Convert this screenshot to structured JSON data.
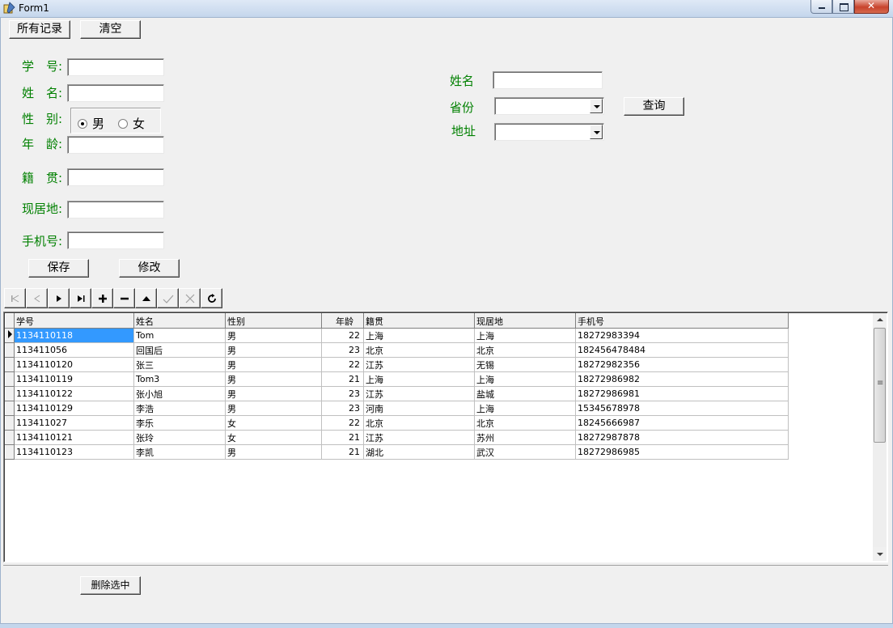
{
  "window": {
    "title": "Form1"
  },
  "toolbar": {
    "all_records": "所有记录",
    "clear": "清空"
  },
  "form": {
    "student_id_label": "学　号:",
    "name_label": "姓　名:",
    "gender_label": "性　别:",
    "gender_options": {
      "male": "男",
      "female": "女"
    },
    "gender_selected": "男",
    "age_label": "年　龄:",
    "native_label": "籍　贯:",
    "residence_label": "现居地:",
    "phone_label": "手机号:",
    "save": "保存",
    "modify": "修改"
  },
  "search": {
    "name_label": "姓名",
    "province_label": "省份",
    "address_label": "地址",
    "query": "查询"
  },
  "navigator": {
    "buttons": [
      "first-icon",
      "prior-icon",
      "next-icon",
      "last-icon",
      "insert-icon",
      "delete-icon",
      "edit-icon",
      "post-icon",
      "cancel-icon",
      "refresh-icon"
    ]
  },
  "grid": {
    "columns": [
      "学号",
      "姓名",
      "性别",
      "年龄",
      "籍贯",
      "现居地",
      "手机号"
    ],
    "rows": [
      [
        "1134110118",
        "Tom",
        "男",
        "22",
        "上海",
        "上海",
        "18272983394"
      ],
      [
        "113411056",
        "回国后",
        "男",
        "23",
        "北京",
        "北京",
        "182456478484"
      ],
      [
        "1134110120",
        "张三",
        "男",
        "22",
        "江苏",
        "无锡",
        "18272982356"
      ],
      [
        "1134110119",
        "Tom3",
        "男",
        "21",
        "上海",
        "上海",
        "18272986982"
      ],
      [
        "1134110122",
        "张小旭",
        "男",
        "23",
        "江苏",
        "盐城",
        "18272986981"
      ],
      [
        "1134110129",
        "李浩",
        "男",
        "23",
        "河南",
        "上海",
        "15345678978"
      ],
      [
        "113411027",
        "李乐",
        "女",
        "22",
        "北京",
        "北京",
        "18245666987"
      ],
      [
        "1134110121",
        "张玲",
        "女",
        "21",
        "江苏",
        "苏州",
        "18272987878"
      ],
      [
        "1134110123",
        "李凯",
        "男",
        "21",
        "湖北",
        "武汉",
        "18272986985"
      ]
    ],
    "selected_row": 0
  },
  "footer": {
    "delete_selected": "删除选中"
  }
}
